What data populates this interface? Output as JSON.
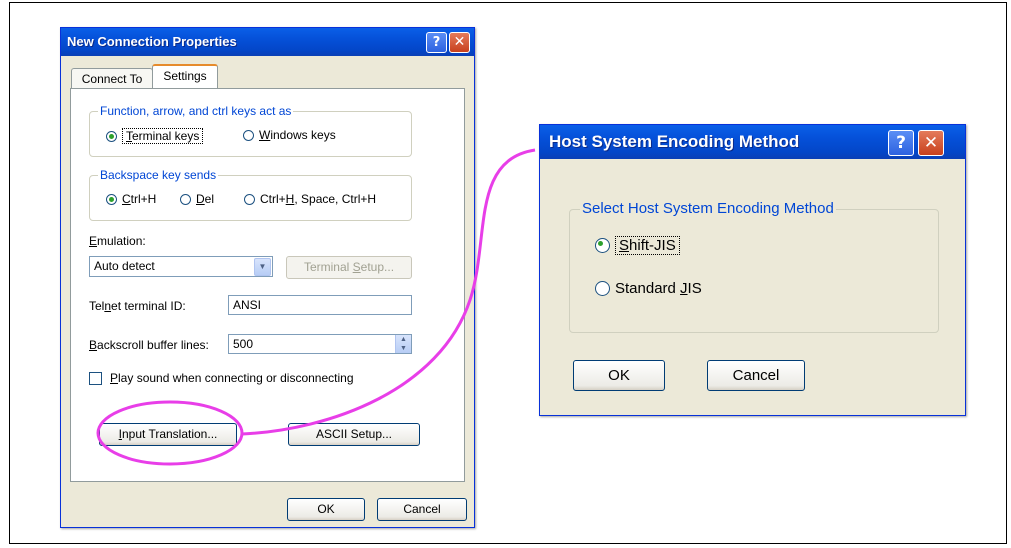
{
  "dialog_main": {
    "title": "New Connection Properties",
    "tabs": [
      {
        "label": "Connect To",
        "active": false
      },
      {
        "label": "Settings",
        "active": true
      }
    ],
    "function_keys_group": {
      "label": "Function, arrow, and ctrl keys act as",
      "options": [
        {
          "pre": "",
          "ul": "T",
          "post": "erminal keys",
          "selected": true
        },
        {
          "pre": "",
          "ul": "W",
          "post": "indows keys",
          "selected": false
        }
      ]
    },
    "backspace_group": {
      "label": "Backspace key sends",
      "options": [
        {
          "pre": "",
          "ul": "C",
          "post": "trl+H",
          "selected": true
        },
        {
          "pre": "",
          "ul": "D",
          "post": "el",
          "selected": false
        },
        {
          "pre": "Ctrl+",
          "ul": "H",
          "post": ", Space, Ctrl+H",
          "selected": false
        }
      ]
    },
    "emulation": {
      "pre": "",
      "ul": "E",
      "post": "mulation:",
      "value": "Auto detect"
    },
    "terminal_setup": {
      "pre": "Terminal ",
      "ul": "S",
      "post": "etup...",
      "enabled": false
    },
    "telnet_id": {
      "pre": "Tel",
      "ul": "n",
      "post": "et terminal ID:",
      "value": "ANSI"
    },
    "backscroll": {
      "pre": "",
      "ul": "B",
      "post": "ackscroll buffer lines:",
      "value": "500"
    },
    "play_sound": {
      "pre": "",
      "ul": "P",
      "post": "lay sound when connecting or disconnecting",
      "checked": false
    },
    "input_translation": {
      "pre": "",
      "ul": "I",
      "post": "nput Translation..."
    },
    "ascii_setup": {
      "label": "ASCII Setup..."
    },
    "ok": "OK",
    "cancel": "Cancel"
  },
  "dialog_encoding": {
    "title": "Host System Encoding Method",
    "group_label": "Select Host System Encoding Method",
    "options": [
      {
        "pre": "",
        "ul": "S",
        "post": "hift-JIS",
        "selected": true
      },
      {
        "pre": "Standard ",
        "ul": "J",
        "post": "IS",
        "selected": false
      }
    ],
    "ok": "OK",
    "cancel": "Cancel"
  },
  "annotation": {
    "highlight_color": "#e83ee8"
  },
  "icons": {
    "help": "?",
    "close": "✕",
    "dropdown": "▼",
    "spin_up": "▲",
    "spin_down": "▼"
  }
}
